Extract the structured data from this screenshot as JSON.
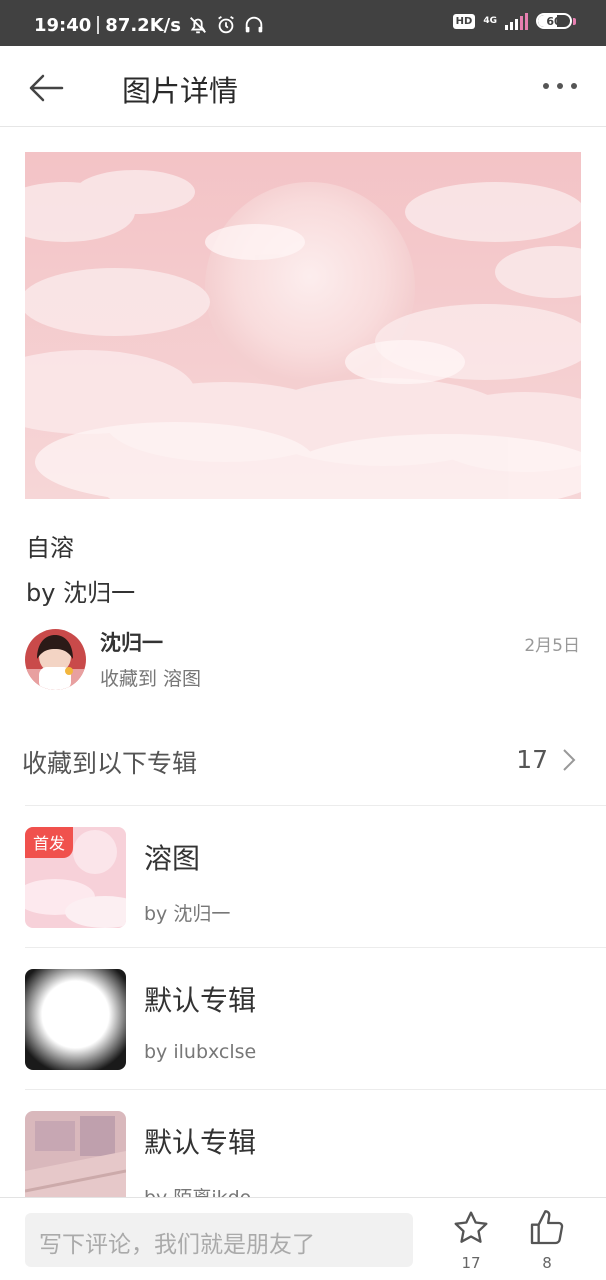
{
  "status_bar": {
    "time": "19:40",
    "speed": "87.2K/s",
    "hd": "HD",
    "network": "4G",
    "battery": "60",
    "battery_level": 0.6
  },
  "header": {
    "title": "图片详情",
    "back_icon": "arrow-left-icon",
    "more_icon": "more-horizontal-icon"
  },
  "picture": {
    "title": "自溶",
    "by": "by 沈归一"
  },
  "author": {
    "name": "沈归一",
    "collected_to": "收藏到 溶图",
    "date": "2月5日"
  },
  "albums_section": {
    "title": "收藏到以下专辑",
    "count": "17"
  },
  "albums": [
    {
      "badge": "首发",
      "name": "溶图",
      "by": "by 沈归一"
    },
    {
      "name": "默认专辑",
      "by": "by ilubxclse"
    },
    {
      "name": "默认专辑",
      "by": "by 陌离ikdo"
    }
  ],
  "bottom_bar": {
    "comment_placeholder": "写下评论，我们就是朋友了",
    "favorite_count": "17",
    "like_count": "8"
  },
  "colors": {
    "status_bar_bg": "#414141",
    "badge_red": "#f0514d",
    "hero_pink": "#f4c9ca"
  }
}
